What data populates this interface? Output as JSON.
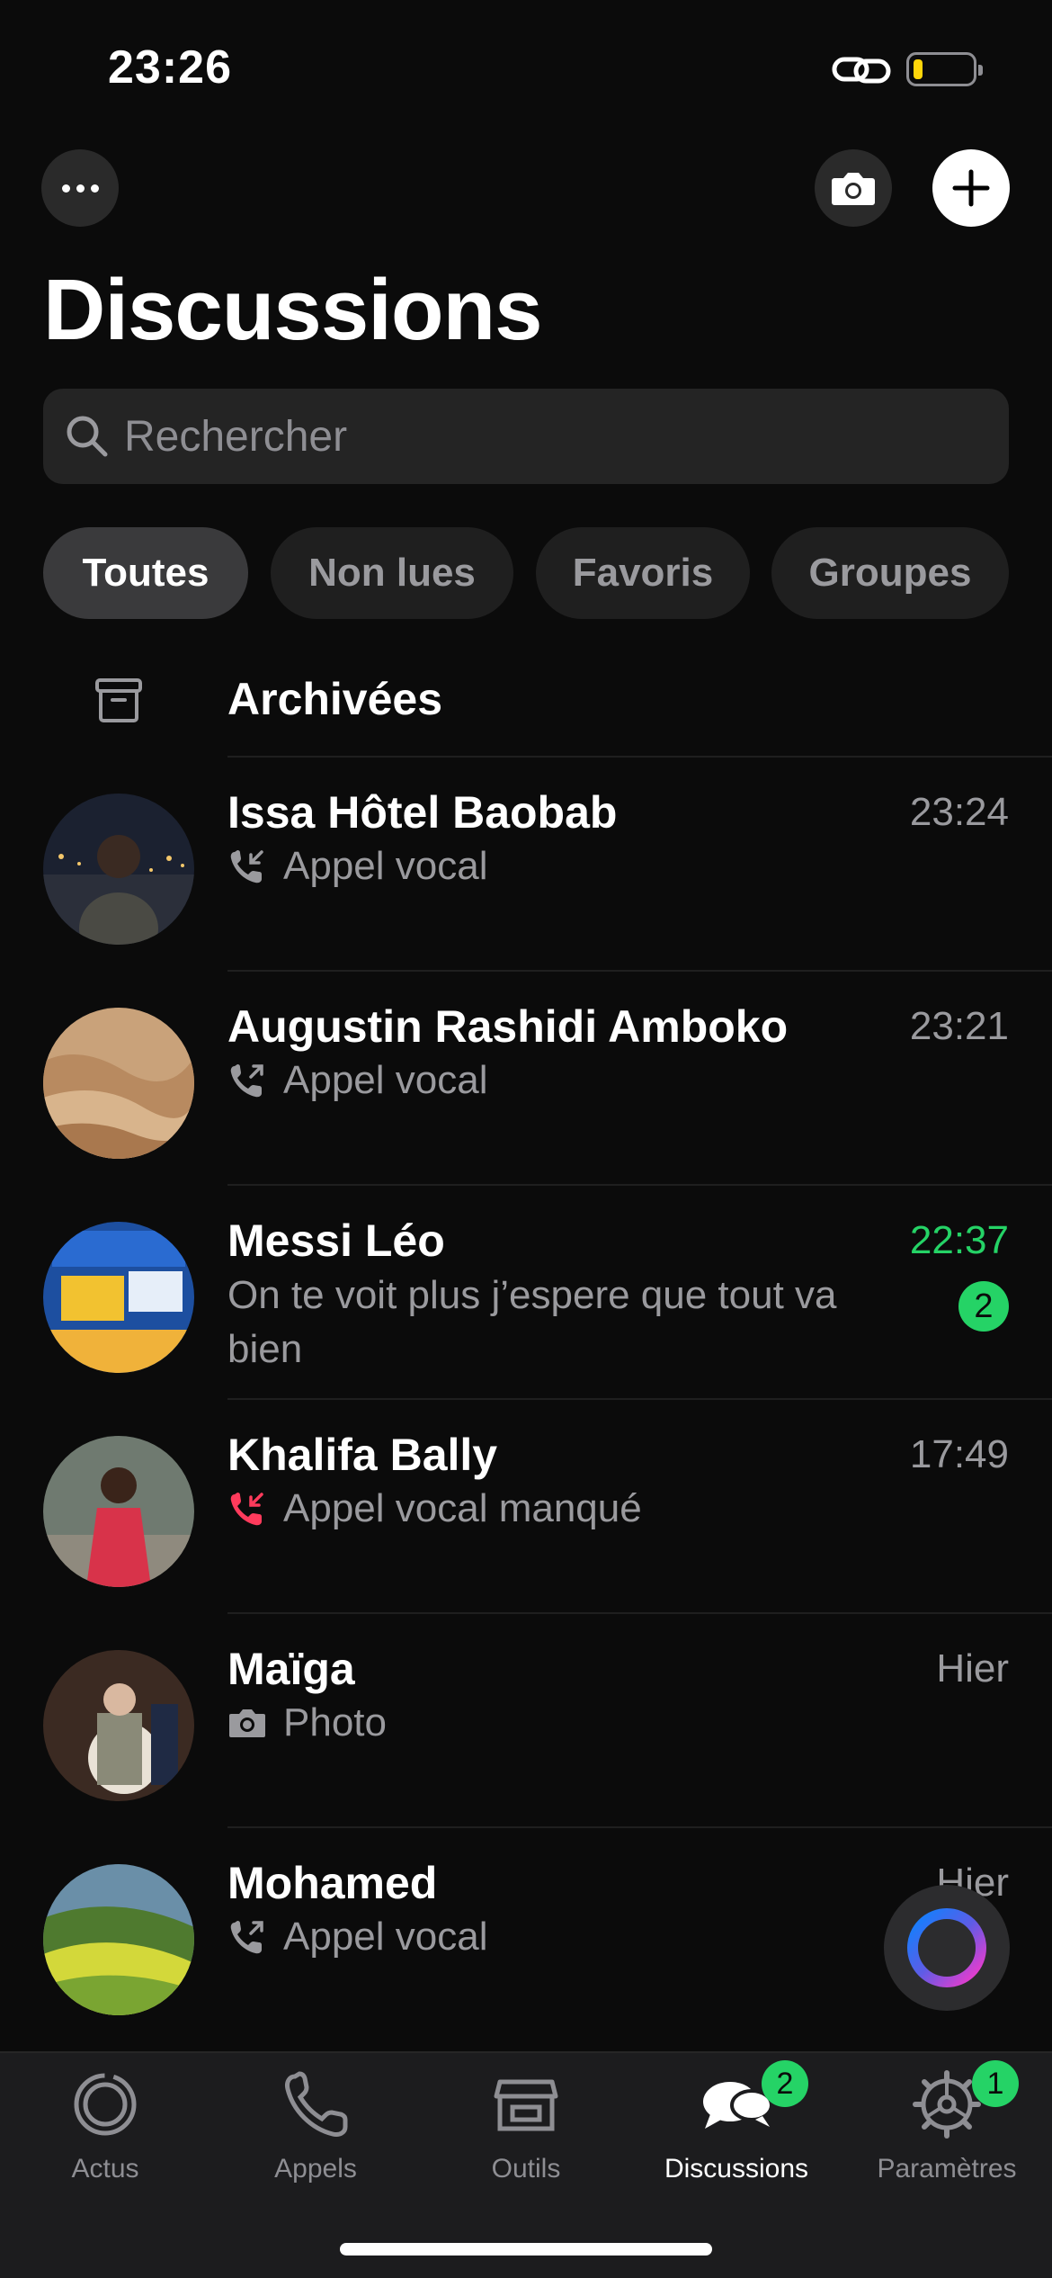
{
  "status_bar": {
    "time": "23:26"
  },
  "header": {
    "title": "Discussions"
  },
  "search": {
    "placeholder": "Rechercher"
  },
  "filters": [
    "Toutes",
    "Non lues",
    "Favoris",
    "Groupes"
  ],
  "archived": {
    "label": "Archivées"
  },
  "chats": [
    {
      "name": "Issa Hôtel Baobab",
      "time": "23:24",
      "preview": "Appel vocal",
      "icon": "incoming-call-icon"
    },
    {
      "name": "Augustin Rashidi Amboko",
      "time": "23:21",
      "preview": "Appel vocal",
      "icon": "outgoing-call-icon"
    },
    {
      "name": "Messi Léo",
      "time": "22:37",
      "preview": "On te voit plus j’espere que tout va bien",
      "unread": "2"
    },
    {
      "name": "Khalifa Bally",
      "time": "17:49",
      "preview": "Appel vocal manqué",
      "icon": "missed-call-icon"
    },
    {
      "name": "Maïga",
      "time": "Hier",
      "preview": "Photo",
      "icon": "camera-icon"
    },
    {
      "name": "Mohamed",
      "time": "Hier",
      "preview": "Appel vocal",
      "icon": "outgoing-call-icon"
    }
  ],
  "tabs": [
    {
      "label": "Actus",
      "icon": "updates-icon"
    },
    {
      "label": "Appels",
      "icon": "phone-icon"
    },
    {
      "label": "Outils",
      "icon": "store-icon"
    },
    {
      "label": "Discussions",
      "icon": "chats-icon",
      "badge": "2",
      "active": true
    },
    {
      "label": "Paramètres",
      "icon": "gear-icon",
      "badge": "1"
    }
  ],
  "colors": {
    "accent": "#25d366",
    "missed": "#ff3b5c",
    "background": "#0b0b0b"
  }
}
